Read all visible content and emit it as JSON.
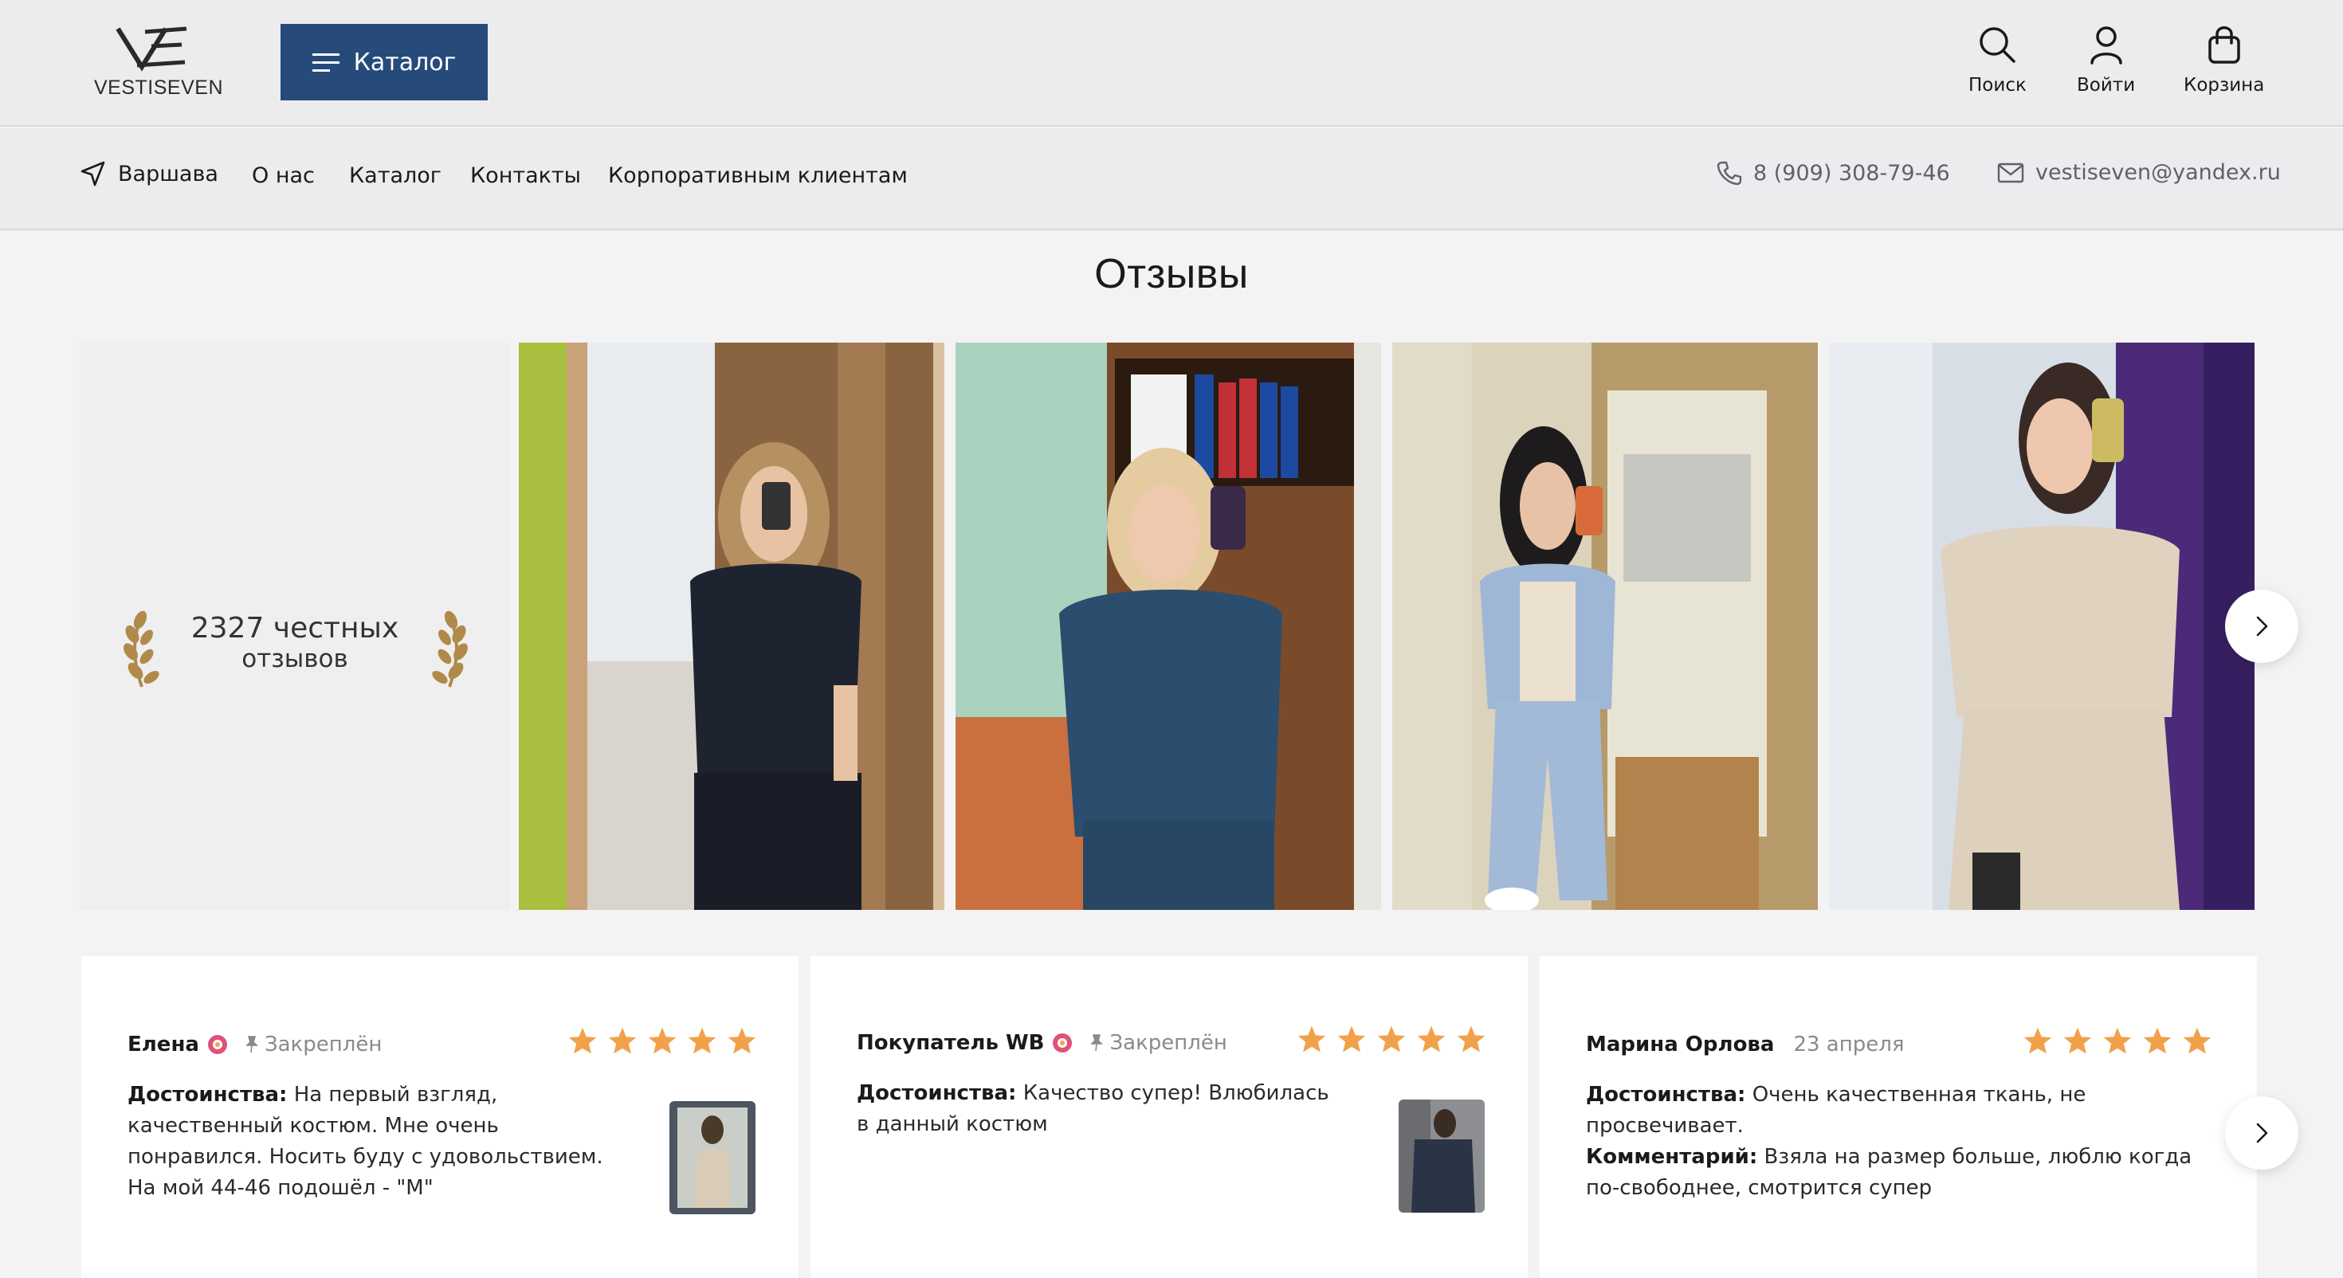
{
  "header": {
    "logo_text": "VESTISEVEN",
    "catalog_label": "Каталог",
    "actions": [
      {
        "label": "Поиск",
        "icon": "search-icon"
      },
      {
        "label": "Войти",
        "icon": "user-icon"
      },
      {
        "label": "Корзина",
        "icon": "bag-icon"
      }
    ],
    "accent_color": "#264a7a"
  },
  "nav": {
    "city": "Варшава",
    "links": [
      "О нас",
      "Каталог",
      "Контакты",
      "Корпоративным клиентам"
    ],
    "phone": "8 (909) 308-79-46",
    "email": "vestiseven@yandex.ru"
  },
  "reviews": {
    "title": "Отзывы",
    "count_line1": "2327 честных",
    "count_line2": "отзывов",
    "laurel_color": "#b08a4a",
    "star_color": "#f2a14b",
    "items": [
      {
        "name": "Елена",
        "pinned": "Закреплён",
        "date": "",
        "rating": 5,
        "pros_label": "Достоинства:",
        "pros": "На первый взгляд, качественный костюм. Мне очень понравился. Носить буду с удовольствием. На мой 44-46 подошёл - \"М\"",
        "comment_label": "",
        "comment": ""
      },
      {
        "name": "Покупатель WB",
        "pinned": "Закреплён",
        "date": "",
        "rating": 5,
        "pros_label": "Достоинства:",
        "pros": "Качество супер! Влюбилась в данный костюм",
        "comment_label": "",
        "comment": ""
      },
      {
        "name": "Марина Орлова",
        "pinned": "",
        "date": "23 апреля",
        "rating": 5,
        "pros_label": "Достоинства:",
        "pros": "Очень качественная ткань, не просвечивает.",
        "comment_label": "Комментарий:",
        "comment": "Взяла на размер больше, люблю когда по-свободнее, смотрится супер"
      }
    ]
  }
}
